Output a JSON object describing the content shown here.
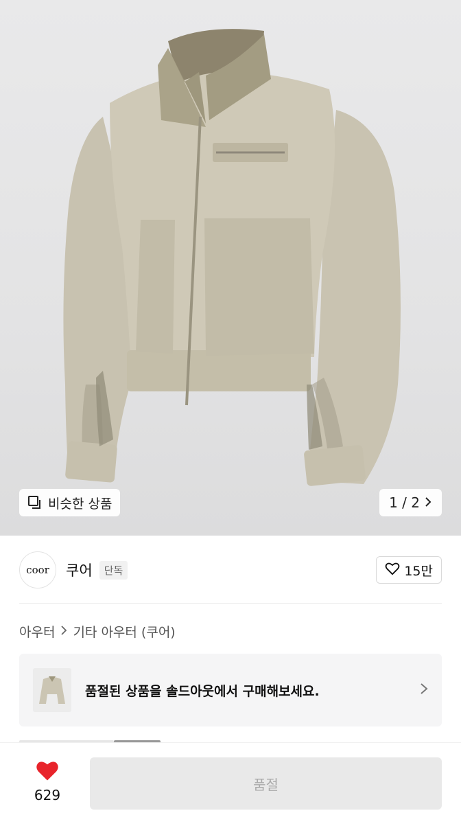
{
  "product_image": {
    "similar_button_label": "비슷한 상품",
    "pager_text": "1 / 2",
    "pager_icon": "chevron-right-icon"
  },
  "brand": {
    "logo_text": "coor",
    "name": "쿠어",
    "badge": "단독",
    "like_count": "15만",
    "like_icon": "heart-outline-icon"
  },
  "breadcrumb": {
    "items": [
      "아우터",
      "기타 아우터 (쿠어)"
    ]
  },
  "soldout_banner": {
    "text": "품절된 상품을 솔드아웃에서 구매해보세요."
  },
  "bottom_bar": {
    "wish_count": "629",
    "wish_icon": "heart-filled-icon",
    "buy_label": "품절"
  },
  "colors": {
    "accent_red": "#e8242b",
    "disabled_button": "#e9e9e9"
  }
}
